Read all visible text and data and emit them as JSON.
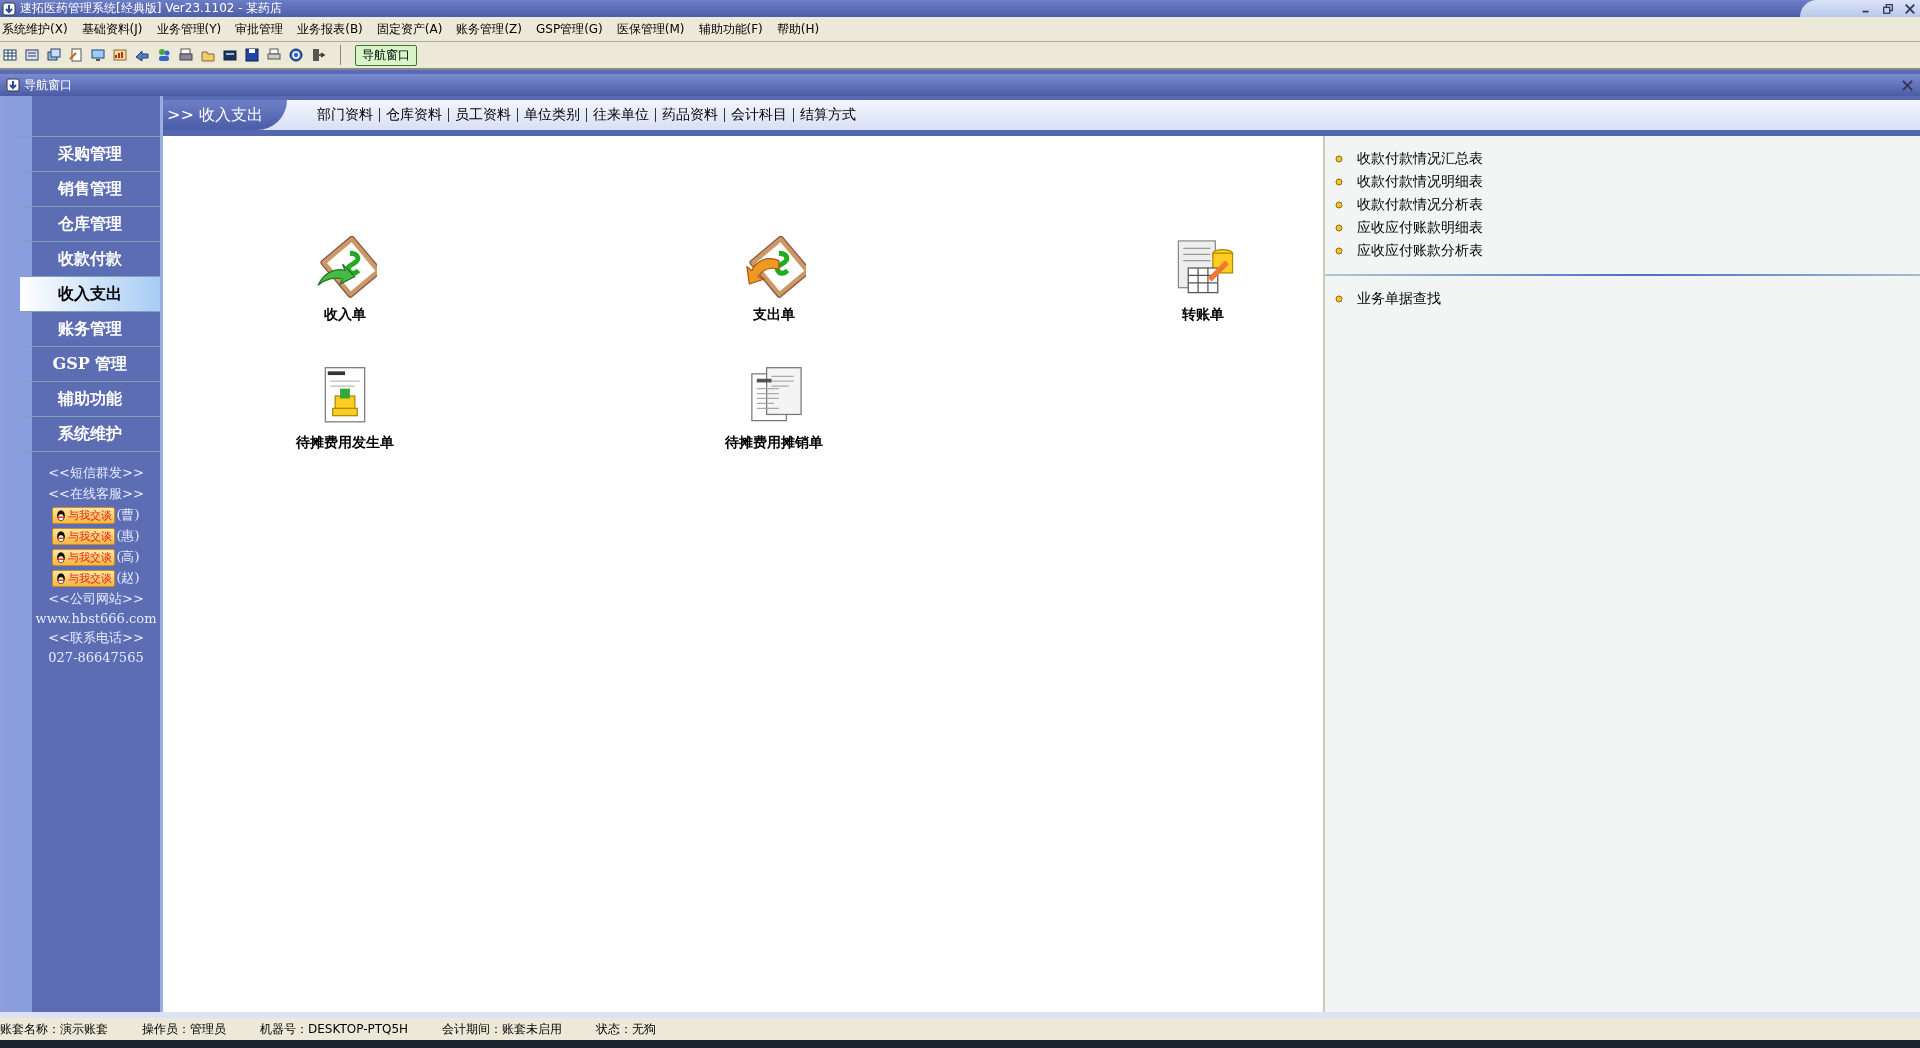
{
  "window": {
    "title": "速拓医药管理系统[经典版] Ver23.1102  -  某药店"
  },
  "menu": [
    "系统维护(X)",
    "基础资料(J)",
    "业务管理(Y)",
    "审批管理",
    "业务报表(B)",
    "固定资产(A)",
    "账务管理(Z)",
    "GSP管理(G)",
    "医保管理(M)",
    "辅助功能(F)",
    "帮助(H)"
  ],
  "toolbar": {
    "button": "导航窗口"
  },
  "nav_window": {
    "title": "导航窗口"
  },
  "sidebar": {
    "items": [
      {
        "label": "采购管理",
        "selected": false
      },
      {
        "label": "销售管理",
        "selected": false
      },
      {
        "label": "仓库管理",
        "selected": false
      },
      {
        "label": "收款付款",
        "selected": false
      },
      {
        "label": "收入支出",
        "selected": true
      },
      {
        "label": "账务管理",
        "selected": false
      },
      {
        "label": "GSP 管理",
        "selected": false
      },
      {
        "label": "辅助功能",
        "selected": false
      },
      {
        "label": "系统维护",
        "selected": false
      }
    ],
    "links": [
      {
        "kind": "link",
        "text": "<<短信群发>>"
      },
      {
        "kind": "link",
        "text": "<<在线客服>>"
      },
      {
        "kind": "chat",
        "button": "与我交谈",
        "text": "(曹)"
      },
      {
        "kind": "chat",
        "button": "与我交谈",
        "text": "(惠)"
      },
      {
        "kind": "chat",
        "button": "与我交谈",
        "text": "(高)"
      },
      {
        "kind": "chat",
        "button": "与我交谈",
        "text": "(赵)"
      },
      {
        "kind": "link",
        "text": "<<公司网站>>"
      },
      {
        "kind": "text",
        "text": "www.hbst666.com"
      },
      {
        "kind": "link",
        "text": "<<联系电话>>"
      },
      {
        "kind": "text",
        "text": "027-86647565"
      }
    ]
  },
  "section": {
    "title": ">> 收入支出",
    "links": [
      "部门资料",
      "仓库资料",
      "员工资料",
      "单位类别",
      "往来单位",
      "药品资料",
      "会计科目",
      "结算方式"
    ]
  },
  "documents": [
    {
      "kind": "income",
      "label": "收入单"
    },
    {
      "kind": "expense",
      "label": "支出单"
    },
    {
      "kind": "transfer",
      "label": "转账单"
    },
    {
      "kind": "pending",
      "label": "待摊费用发生单"
    },
    {
      "kind": "amortize",
      "label": "待摊费用摊销单"
    }
  ],
  "reports": {
    "groups": [
      [
        "收款付款情况汇总表",
        "收款付款情况明细表",
        "收款付款情况分析表",
        "应收应付账款明细表",
        "应收应付账款分析表"
      ],
      [
        "业务单据查找"
      ]
    ]
  },
  "status_bar": [
    "账套名称：演示账套",
    "操作员：管理员",
    "机器号：DESKTOP-PTQ5H",
    "会计期间：账套未启用",
    "状态：无狗"
  ]
}
